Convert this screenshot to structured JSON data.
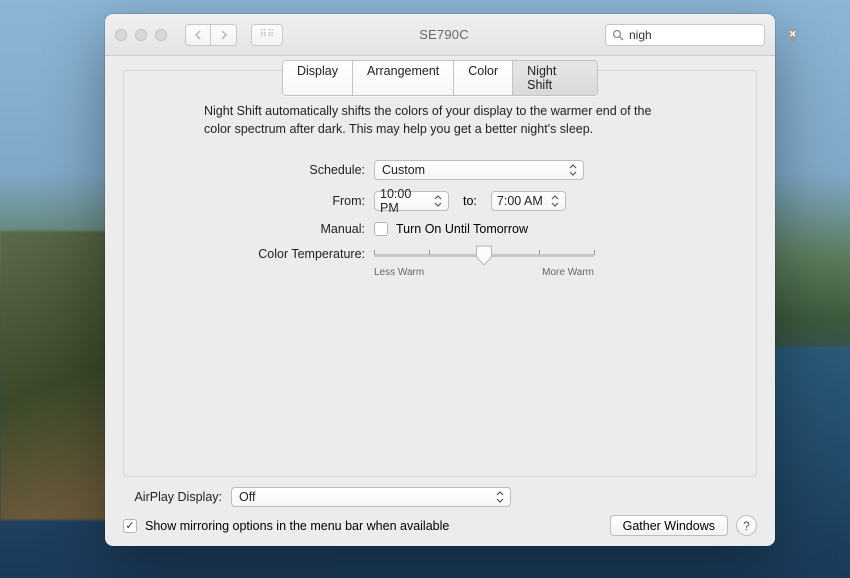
{
  "titlebar": {
    "title": "SE790C",
    "search_value": "nigh"
  },
  "tabs": [
    "Display",
    "Arrangement",
    "Color",
    "Night Shift"
  ],
  "active_tab_index": 3,
  "description": "Night Shift automatically shifts the colors of your display to the warmer end of the color spectrum after dark. This may help you get a better night's sleep.",
  "form": {
    "schedule_label": "Schedule:",
    "schedule_value": "Custom",
    "from_label": "From:",
    "from_value": "10:00 PM",
    "to_label": "to:",
    "to_value": "7:00 AM",
    "manual_label": "Manual:",
    "manual_checkbox_label": "Turn On Until Tomorrow",
    "manual_checked": false,
    "temperature_label": "Color Temperature:",
    "slider_min_label": "Less Warm",
    "slider_max_label": "More Warm",
    "slider_value": 0.5
  },
  "airplay": {
    "label": "AirPlay Display:",
    "value": "Off"
  },
  "footer": {
    "mirroring_checked": true,
    "mirroring_label": "Show mirroring options in the menu bar when available",
    "gather_label": "Gather Windows",
    "help_label": "?"
  }
}
